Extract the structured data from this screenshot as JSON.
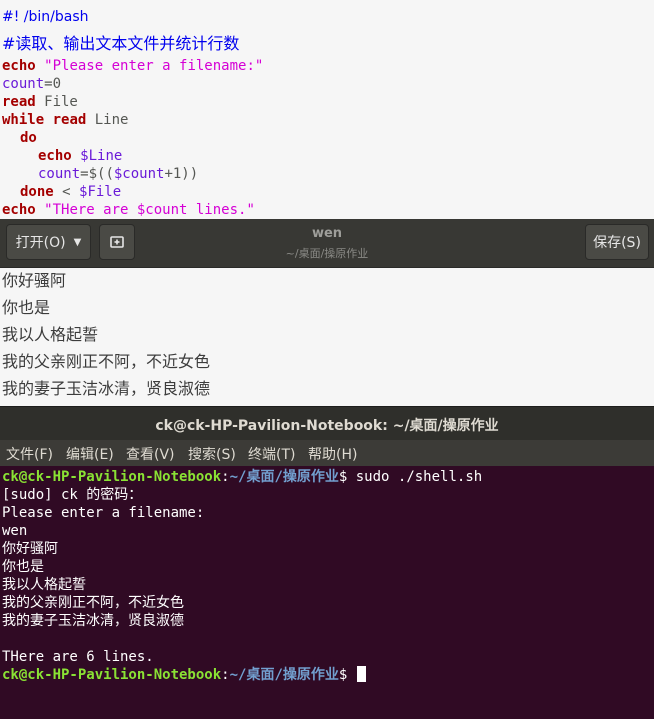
{
  "code": {
    "lines": [
      {
        "shebang": "#! /bin/bash"
      },
      {
        "comment": "#读取、输出文本文件并统计行数"
      },
      {
        "kw": "echo",
        "str": "\"Please enter a filename:\""
      },
      {
        "var": "count",
        "rest": "=0"
      },
      {
        "kw": "read",
        "plain": " File"
      },
      {
        "kw1": "while",
        "kw2": "read",
        "plain": " Line"
      },
      {
        "kw": "do"
      },
      {
        "kw": "echo",
        "var": "$Line"
      },
      {
        "var": "count",
        "eq": "=$((",
        "var2": "$count",
        "rest": "+1))"
      },
      {
        "kw": "done",
        "lt": " < ",
        "var": "$File"
      },
      {
        "kw": "echo",
        "str": "\"THere are $count lines.\""
      }
    ]
  },
  "gedit": {
    "open_label": "打开(O)",
    "title": "wen",
    "subtitle": "~/桌面/操原作业",
    "save_label": "保存(S)",
    "document_lines": [
      "你好骚阿",
      "你也是",
      "我以人格起誓",
      "我的父亲刚正不阿，不近女色",
      "我的妻子玉洁冰清，贤良淑德"
    ]
  },
  "terminal": {
    "title": "ck@ck-HP-Pavilion-Notebook: ~/桌面/操原作业",
    "menu": [
      "文件(F)",
      "编辑(E)",
      "查看(V)",
      "搜索(S)",
      "终端(T)",
      "帮助(H)"
    ],
    "prompt_user": "ck@ck-HP-Pavilion-Notebook",
    "prompt_sep": ":",
    "prompt_path": "~/桌面/操原作业",
    "prompt_dollar": "$",
    "command": " sudo ./shell.sh",
    "output": [
      "[sudo] ck 的密码：",
      "Please enter a filename:",
      "wen",
      "你好骚阿",
      "你也是",
      "我以人格起誓",
      "我的父亲刚正不阿，不近女色",
      "我的妻子玉洁冰清，贤良淑德",
      "",
      "THere are 6 lines."
    ]
  }
}
